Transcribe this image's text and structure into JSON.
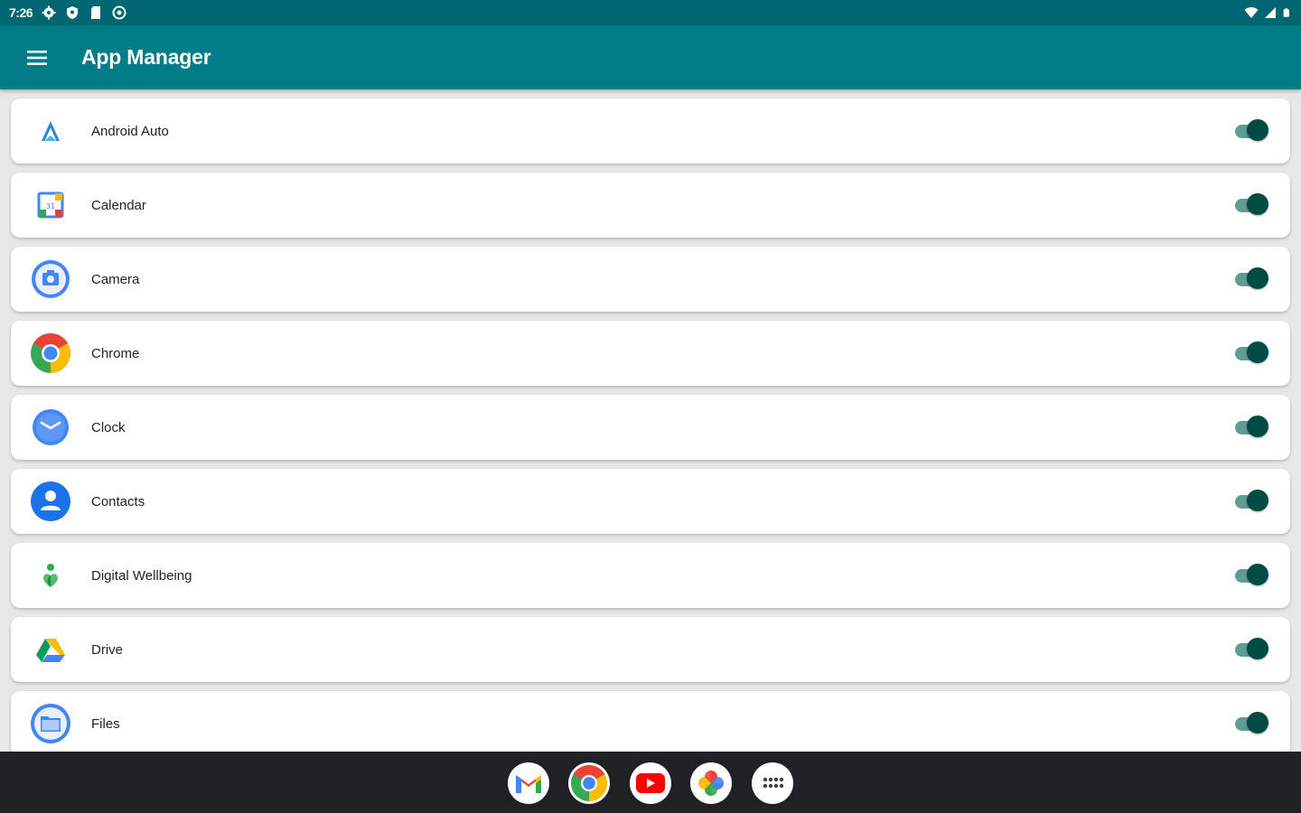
{
  "statusbar": {
    "time": "7:26",
    "left_icons": [
      "settings-icon",
      "shield-icon",
      "sd-card-icon",
      "vpn-icon"
    ],
    "right_icons": [
      "wifi-icon",
      "cellular-signal-icon",
      "battery-icon"
    ]
  },
  "appbar": {
    "title": "App Manager",
    "menu_icon": "menu-icon"
  },
  "apps": [
    {
      "label": "Android Auto",
      "icon": "android-auto-icon",
      "enabled": true
    },
    {
      "label": "Calendar",
      "icon": "calendar-icon",
      "enabled": true
    },
    {
      "label": "Camera",
      "icon": "camera-icon",
      "enabled": true
    },
    {
      "label": "Chrome",
      "icon": "chrome-icon",
      "enabled": true
    },
    {
      "label": "Clock",
      "icon": "clock-icon",
      "enabled": true
    },
    {
      "label": "Contacts",
      "icon": "contacts-icon",
      "enabled": true
    },
    {
      "label": "Digital Wellbeing",
      "icon": "digital-wellbeing-icon",
      "enabled": true
    },
    {
      "label": "Drive",
      "icon": "drive-icon",
      "enabled": true
    },
    {
      "label": "Files",
      "icon": "files-icon",
      "enabled": true
    }
  ],
  "taskbar": {
    "apps": [
      "gmail-icon",
      "chrome-icon",
      "youtube-icon",
      "photos-icon",
      "app-drawer-icon"
    ]
  },
  "colors": {
    "statusbar": "#00666f",
    "appbar": "#007d87",
    "toggle_thumb": "#004c44",
    "toggle_track": "#5f9c92",
    "taskbar": "#202124"
  }
}
